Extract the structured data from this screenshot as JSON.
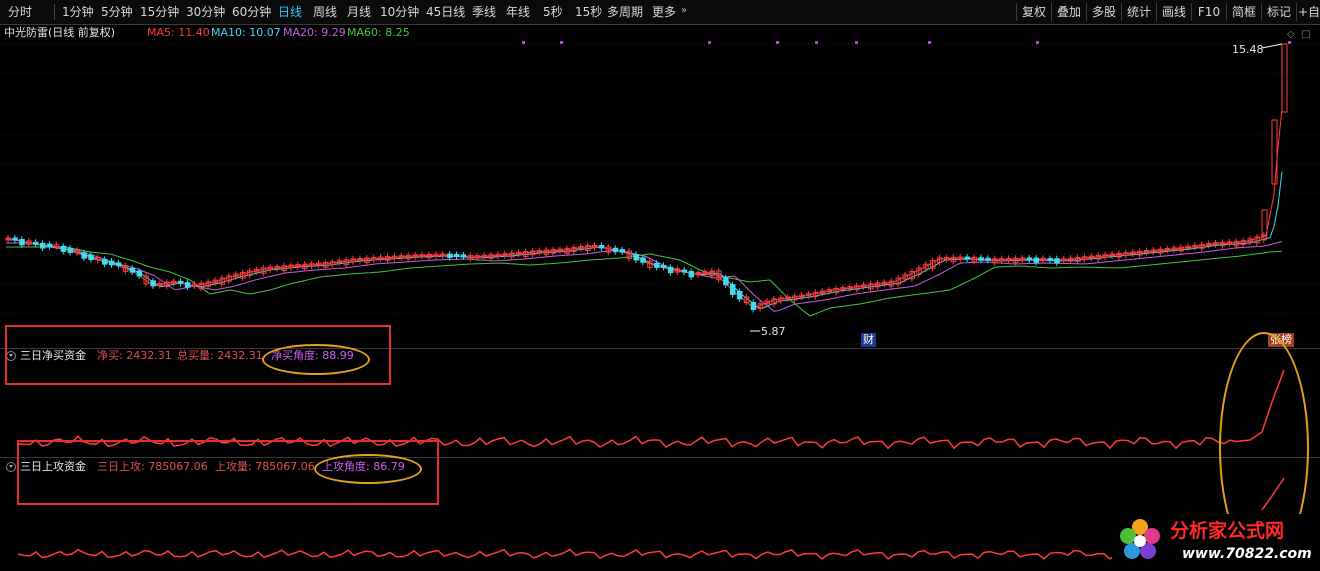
{
  "toolbar": {
    "periods": [
      "分时",
      "1分钟",
      "5分钟",
      "15分钟",
      "30分钟",
      "60分钟",
      "日线",
      "周线",
      "月线",
      "10分钟",
      "45日线",
      "季线",
      "年线",
      "5秒",
      "15秒",
      "多周期",
      "更多"
    ],
    "active_period": "日线",
    "right_tools": [
      "复权",
      "叠加",
      "多股",
      "统计",
      "画线",
      "F10",
      "简框",
      "标记",
      "+自"
    ]
  },
  "main": {
    "title": "中光防雷(日线 前复权)",
    "ma": [
      {
        "label": "MA5: 11.40",
        "color": "#ff3b3b"
      },
      {
        "label": "MA10: 10.07",
        "color": "#3fdcf0"
      },
      {
        "label": "MA20: 9.29",
        "color": "#c060e0"
      },
      {
        "label": "MA60: 8.25",
        "color": "#3fc93f"
      }
    ],
    "high_label": "15.48",
    "low_label": "5.87",
    "cai_badge": "财",
    "gubang_badge": "张榜"
  },
  "panel1": {
    "title": "三日净买资金",
    "net_buy": "净买: 2432.31",
    "total_buy": "总买量: 2432.31",
    "angle": "净买角度: 88.99"
  },
  "panel2": {
    "title": "三日上攻资金",
    "attack": "三日上攻: 785067.06",
    "attack_vol": "上攻量: 785067.06",
    "angle": "上攻角度: 86.79"
  },
  "logo": {
    "name": "分析家公式网",
    "url": "www.70822.com"
  },
  "colors": {
    "up": "#ff3b3b",
    "down": "#3fdcf0",
    "ma5": "#ff3b3b",
    "ma10": "#3fdcf0",
    "ma20": "#c060e0",
    "ma60": "#3fc93f",
    "label_net": "#e05050",
    "label_angle": "#d060f0",
    "annotation_red": "#e23030",
    "annotation_gold": "#e3a21b"
  }
}
